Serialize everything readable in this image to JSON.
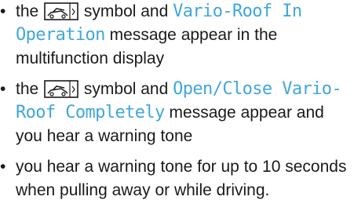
{
  "bullet_char": "•",
  "colors": {
    "display_text": "#3fa7dc",
    "body_text": "#1a1a1a"
  },
  "icons": {
    "roof_symbol": "convertible-roof-icon"
  },
  "items": [
    {
      "t1": "the",
      "t2": "symbol and",
      "msg": "Vario-Roof In Operation",
      "t3": "message appear in the multifunction display"
    },
    {
      "t1": "the",
      "t2": "symbol and",
      "msg": "Open/Close Vario-Roof Completely",
      "t3": "message appear and you hear a warning tone"
    },
    {
      "t1": "you hear a warning tone for up to 10 seconds when pulling away or while driving."
    }
  ]
}
